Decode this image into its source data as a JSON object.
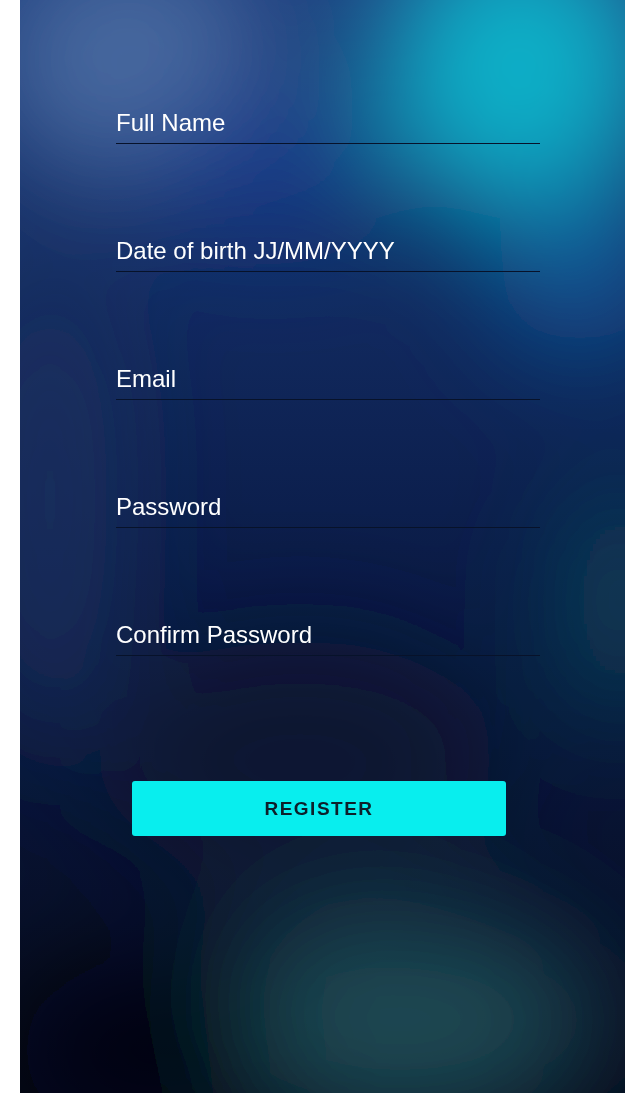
{
  "form": {
    "fields": [
      {
        "placeholder": "Full Name"
      },
      {
        "placeholder": "Date of birth JJ/MM/YYYY"
      },
      {
        "placeholder": "Email"
      },
      {
        "placeholder": "Password"
      },
      {
        "placeholder": "Confirm Password"
      }
    ],
    "submit_button": {
      "label": "REGISTER"
    }
  }
}
